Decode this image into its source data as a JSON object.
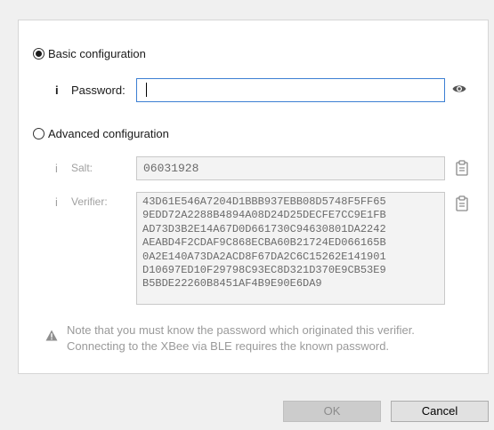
{
  "basic": {
    "label": "Basic configuration",
    "selected": true
  },
  "password": {
    "info": "i",
    "label": "Password:",
    "value": ""
  },
  "advanced": {
    "label": "Advanced configuration",
    "selected": false
  },
  "salt": {
    "info": "i",
    "label": "Salt:",
    "value": "06031928"
  },
  "verifier": {
    "info": "i",
    "label": "Verifier:",
    "lines": [
      "43D61E546A7204D1BBB937EBB08D5748F5FF65",
      "9EDD72A2288B4894A08D24D25DECFE7CC9E1FB",
      "AD73D3B2E14A67D0D661730C94630801DA2242",
      "AEABD4F2CDAF9C868ECBA60B21724ED066165B",
      "0A2E140A73DA2ACD8F67DA2C6C15262E141901",
      "D10697ED10F29798C93EC8D321D370E9CB53E9",
      "B5BDE22260B8451AF4B9E90E6DA9"
    ]
  },
  "note": "Note that you must know the password which originated this verifier. Connecting to the XBee via BLE requires the known password.",
  "buttons": {
    "ok": "OK",
    "cancel": "Cancel"
  },
  "icons": {
    "eye": "eye-icon",
    "clipboard": "clipboard-icon",
    "warning": "warning-icon"
  }
}
